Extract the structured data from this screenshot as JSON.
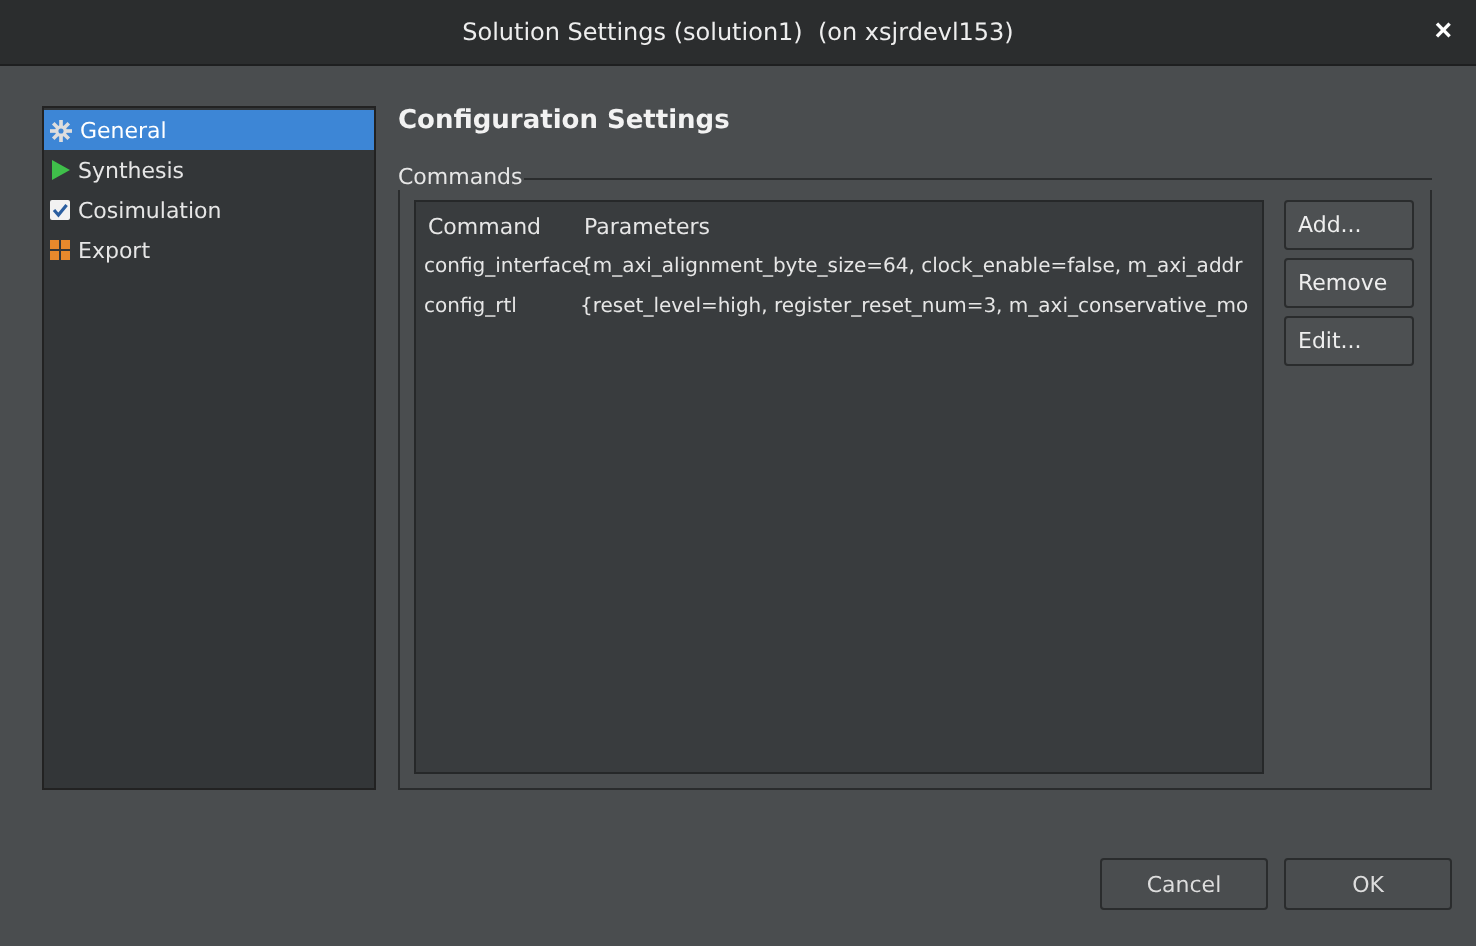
{
  "window": {
    "title": "Solution Settings (solution1)  (on xsjrdevl153)",
    "close": "×"
  },
  "sidebar": {
    "items": [
      {
        "label": "General",
        "selected": true
      },
      {
        "label": "Synthesis",
        "selected": false
      },
      {
        "label": "Cosimulation",
        "selected": false
      },
      {
        "label": "Export",
        "selected": false
      }
    ]
  },
  "heading": "Configuration Settings",
  "commands": {
    "legend": "Commands",
    "table": {
      "columns": [
        "Command",
        "Parameters"
      ],
      "rows": [
        [
          "config_interface",
          "{m_axi_alignment_byte_size=64, clock_enable=false, m_axi_addr"
        ],
        [
          "config_rtl",
          "{reset_level=high, register_reset_num=3, m_axi_conservative_mo"
        ]
      ]
    },
    "buttons": [
      "Add...",
      "Remove",
      "Edit..."
    ]
  },
  "footer_buttons": [
    "Cancel",
    "OK"
  ]
}
